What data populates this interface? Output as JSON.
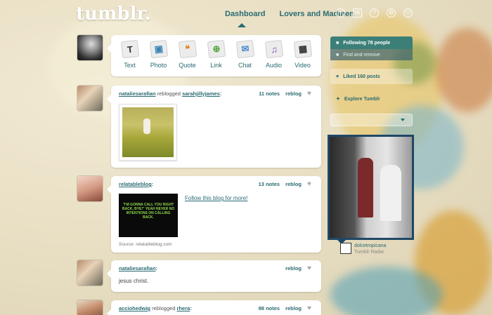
{
  "header": {
    "logo": "tumblr.",
    "nav": [
      "Dashboard",
      "Lovers and Madmen"
    ],
    "icons": [
      "add-icon",
      "mail-icon",
      "help-icon",
      "gear-icon",
      "power-icon"
    ]
  },
  "post_types": [
    {
      "label": "Text",
      "icon": "text-icon",
      "glyph": "T"
    },
    {
      "label": "Photo",
      "icon": "photo-icon",
      "glyph": "▣"
    },
    {
      "label": "Quote",
      "icon": "quote-icon",
      "glyph": "❝"
    },
    {
      "label": "Link",
      "icon": "link-icon",
      "glyph": "⊕"
    },
    {
      "label": "Chat",
      "icon": "chat-icon",
      "glyph": "✉"
    },
    {
      "label": "Audio",
      "icon": "audio-icon",
      "glyph": "♫"
    },
    {
      "label": "Video",
      "icon": "video-icon",
      "glyph": "▦"
    }
  ],
  "posts": [
    {
      "user": "nataliesarafian",
      "action": " reblogged ",
      "source": "sarahjillyjames",
      "suffix": ":",
      "notes": "11 notes",
      "reblog": "reblog"
    },
    {
      "user": "relatableblog",
      "action": "",
      "source": "",
      "suffix": ":",
      "notes": "13 notes",
      "reblog": "reblog",
      "image_text": "\"I'M GONNA CALL YOU RIGHT BACK, BYE!\" YEAH NEVER NO INTENTIONS ON CALLING BACK.",
      "link": "Follow this blog for more!",
      "source_caption": "Source: relatableblog.com"
    },
    {
      "user": "nataliesarafian",
      "action": "",
      "source": "",
      "suffix": ":",
      "notes": "",
      "reblog": "reblog",
      "body": "jesus christ."
    },
    {
      "user": "acciohedwig",
      "action": " reblogged ",
      "source": "rhera",
      "suffix": ":",
      "notes": "98 notes",
      "reblog": "reblog"
    }
  ],
  "sidebar": {
    "following": "Following 78 people",
    "find": "Find and remove",
    "liked": "Liked 160 posts",
    "explore": "Explore Tumblr",
    "radar_user": "dolcetropicana",
    "radar_sub": "Tumblr Radar"
  },
  "colors": {
    "accent": "#2a6b72",
    "panel": "#3c7f78",
    "radar_border": "#1f4866"
  }
}
